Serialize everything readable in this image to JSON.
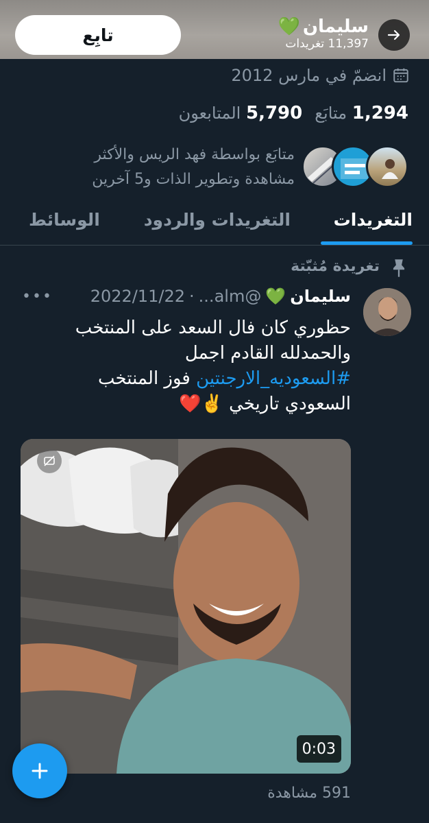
{
  "header": {
    "follow_label": "تابِع",
    "name": "سليمان",
    "name_emoji": "💚",
    "tweet_count": "11,397 تغريدات"
  },
  "profile": {
    "joined": "انضمّ في مارس 2012",
    "following_count": "1,294",
    "following_label": "متابَع",
    "followers_count": "5,790",
    "followers_label": "المتابعون",
    "followed_by_line1": "متابَع بواسطة فهد الريس والأكثر",
    "followed_by_line2": "مشاهدة وتطوير الذات و5 آخرين"
  },
  "tabs": {
    "tweets": "التغريدات",
    "replies": "التغريدات والردود",
    "media": "الوسائط"
  },
  "tweet": {
    "pinned_label": "تغريدة مُثبّتة",
    "name": "سليمان",
    "name_emoji": "💚",
    "handle": "@alm...",
    "separator": "·",
    "date": "2022/11/22",
    "line1": "حظوري كان فال السعد على المنتخب",
    "line2": "والحمدلله القادم اجمل",
    "hashtag": "#السعوديه_الارجنتين",
    "line3_rest": " فوز المنتخب",
    "line4": "السعودي تاريخي ✌️❤️",
    "duration": "0:03",
    "views": "591 مشاهدة"
  },
  "colors": {
    "background": "#15202b",
    "accent": "#1d9bf0",
    "muted": "#8b98a5"
  }
}
